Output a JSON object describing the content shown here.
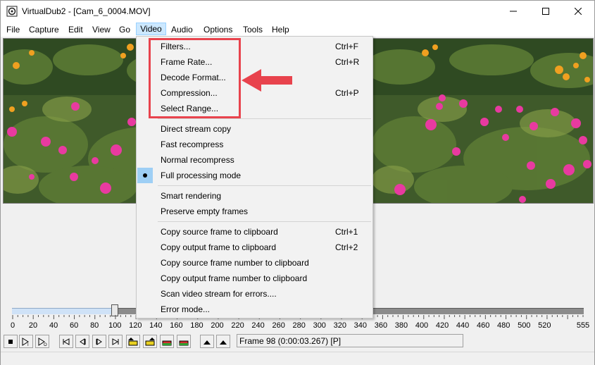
{
  "window": {
    "title": "VirtualDub2 - [Cam_6_0004.MOV]",
    "icons": {
      "app": "app-icon",
      "minimize": "minimize-icon",
      "maximize": "maximize-icon",
      "close": "close-icon"
    }
  },
  "menubar": {
    "items": [
      "File",
      "Capture",
      "Edit",
      "View",
      "Go",
      "Video",
      "Audio",
      "Options",
      "Tools",
      "Help"
    ],
    "active": "Video"
  },
  "video_menu": {
    "items": [
      {
        "label": "Filters...",
        "shortcut": "Ctrl+F"
      },
      {
        "label": "Frame Rate...",
        "shortcut": "Ctrl+R"
      },
      {
        "label": "Decode Format...",
        "shortcut": ""
      },
      {
        "label": "Compression...",
        "shortcut": "Ctrl+P"
      },
      {
        "label": "Select Range...",
        "shortcut": ""
      },
      {
        "label": "Direct stream copy",
        "shortcut": ""
      },
      {
        "label": "Fast recompress",
        "shortcut": ""
      },
      {
        "label": "Normal recompress",
        "shortcut": ""
      },
      {
        "label": "Full processing mode",
        "shortcut": "",
        "checked": true
      },
      {
        "label": "Smart rendering",
        "shortcut": ""
      },
      {
        "label": "Preserve empty frames",
        "shortcut": ""
      },
      {
        "label": "Copy source frame to clipboard",
        "shortcut": "Ctrl+1"
      },
      {
        "label": "Copy output frame to clipboard",
        "shortcut": "Ctrl+2"
      },
      {
        "label": "Copy source frame number to clipboard",
        "shortcut": ""
      },
      {
        "label": "Copy output frame number to clipboard",
        "shortcut": ""
      },
      {
        "label": "Scan video stream for errors....",
        "shortcut": ""
      },
      {
        "label": "Error mode...",
        "shortcut": ""
      }
    ],
    "highlight_color": "#e8434d",
    "check_color": "#9ecff5"
  },
  "timeline": {
    "tick_labels": [
      "0",
      "20",
      "40",
      "60",
      "80",
      "100",
      "120",
      "140",
      "160",
      "180",
      "200",
      "220",
      "240",
      "260",
      "280",
      "300",
      "320",
      "340",
      "360",
      "380",
      "400",
      "420",
      "440",
      "460",
      "480",
      "500",
      "520",
      "555"
    ],
    "max_frame": 555,
    "current_frame": 98
  },
  "toolbar": {
    "frame_readout": "Frame 98 (0:00:03.267) [P]"
  },
  "colors": {
    "annotation_red": "#e8434d",
    "selection_blue": "#cfe2f7"
  }
}
